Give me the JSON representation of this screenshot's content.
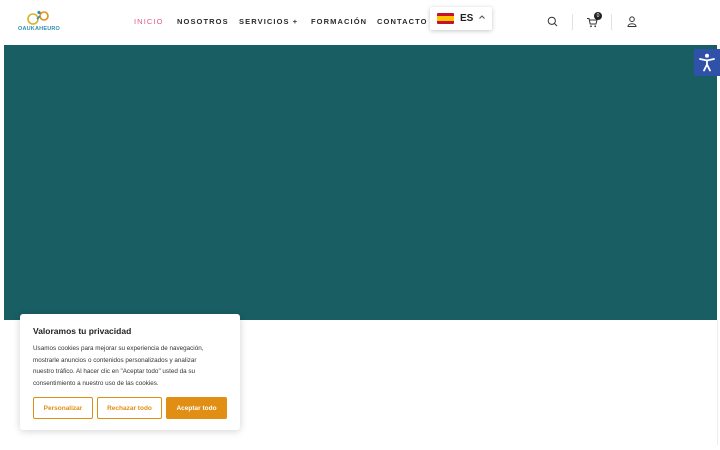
{
  "header": {
    "logo_text": "OAUKAHEURO",
    "nav": [
      {
        "label": "INICIO",
        "active": true
      },
      {
        "label": "NOSOTROS",
        "active": false
      },
      {
        "label": "SERVICIOS +",
        "active": false
      },
      {
        "label": "FORMACIÓN",
        "active": false
      },
      {
        "label": "CONTACTO",
        "active": false
      }
    ],
    "language": {
      "code": "ES",
      "flag": "spain-flag"
    },
    "cart_count": "0",
    "icons": [
      "search-icon",
      "cart-icon",
      "user-icon"
    ]
  },
  "hero": {
    "background": "#185e63"
  },
  "accessibility": {
    "icon": "accessibility-icon",
    "color": "#2f52a8"
  },
  "cookie_banner": {
    "title": "Valoramos tu privacidad",
    "lines": [
      "Usamos cookies para mejorar su experiencia de navegación,",
      "mostrarle anuncios o contenidos personalizados y analizar",
      "nuestro tráfico. Al hacer clic en \"Aceptar todo\" usted da su",
      "consentimiento a nuestro uso de las cookies."
    ],
    "buttons": {
      "customize": "Personalizar",
      "reject": "Rechazar todo",
      "accept": "Aceptar todo"
    },
    "accent": "#e08f14"
  }
}
